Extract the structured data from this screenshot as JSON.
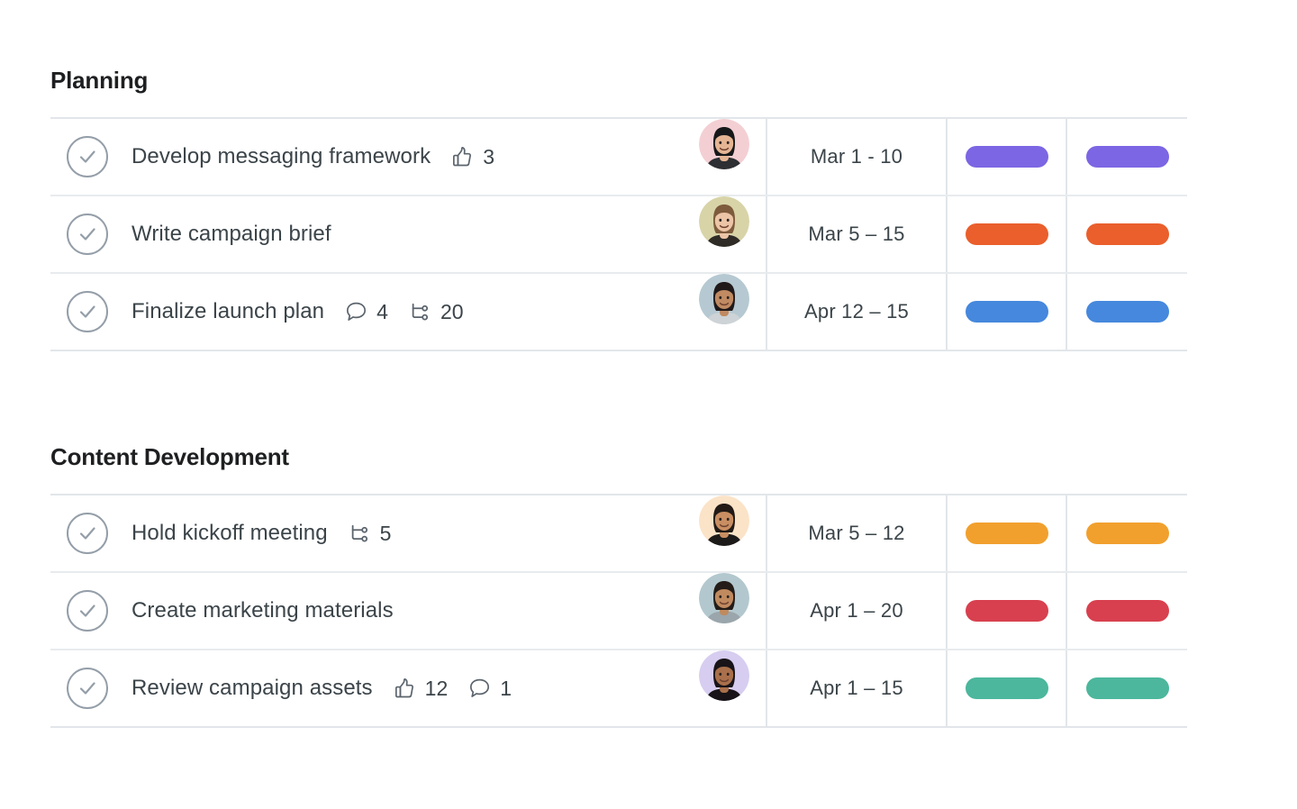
{
  "sections": [
    {
      "id": "planning",
      "title": "Planning",
      "rows": [
        {
          "task": "Develop messaging framework",
          "status_icon": "check-circle-icon",
          "meta": [
            {
              "icon": "thumbs-up-icon",
              "count": "3"
            }
          ],
          "assignee_avatar_bg": "#f3cfd3",
          "assignee_avatar_hair": "#17181a",
          "assignee_avatar_skin": "#e5b594",
          "assignee_avatar_shirt": "#2d2f33",
          "date": "Mar 1 - 10",
          "pill_color": "#7c66e3",
          "pill2_color": "#7c66e3"
        },
        {
          "task": "Write campaign brief",
          "status_icon": "check-circle-icon",
          "meta": [],
          "assignee_avatar_bg": "#d8d4a8",
          "assignee_avatar_hair": "#7d5b3c",
          "assignee_avatar_skin": "#ecc4a6",
          "assignee_avatar_shirt": "#2f2b27",
          "date": "Mar 5 – 15",
          "pill_color": "#ea5f2c",
          "pill2_color": "#ea5f2c"
        },
        {
          "task": "Finalize launch plan",
          "status_icon": "check-circle-icon",
          "meta": [
            {
              "icon": "comment-icon",
              "count": "4"
            },
            {
              "icon": "subtask-icon",
              "count": "20"
            }
          ],
          "assignee_avatar_bg": "#b6c9d2",
          "assignee_avatar_hair": "#20191a",
          "assignee_avatar_skin": "#c08a62",
          "assignee_avatar_shirt": "#cdd3d6",
          "date": "Apr 12 – 15",
          "pill_color": "#4688dd",
          "pill2_color": "#4688dd"
        }
      ]
    },
    {
      "id": "content-development",
      "title": "Content Development",
      "rows": [
        {
          "task": "Hold kickoff meeting",
          "status_icon": "check-circle-icon",
          "meta": [
            {
              "icon": "subtask-icon",
              "count": "5"
            }
          ],
          "assignee_avatar_bg": "#fbe3c8",
          "assignee_avatar_hair": "#221a16",
          "assignee_avatar_skin": "#c98e62",
          "assignee_avatar_shirt": "#1d1b1a",
          "date": "Mar 5 – 12",
          "pill_color": "#f1a02d",
          "pill2_color": "#f1a02d"
        },
        {
          "task": "Create marketing materials",
          "status_icon": "check-circle-icon",
          "meta": [],
          "assignee_avatar_bg": "#b3c8ce",
          "assignee_avatar_hair": "#241c18",
          "assignee_avatar_skin": "#c08a5f",
          "assignee_avatar_shirt": "#9aa6ac",
          "date": "Apr 1 – 20",
          "pill_color": "#d8404f",
          "pill2_color": "#d8404f"
        },
        {
          "task": "Review campaign assets",
          "status_icon": "check-circle-icon",
          "meta": [
            {
              "icon": "thumbs-up-icon",
              "count": "12"
            },
            {
              "icon": "comment-icon",
              "count": "1"
            }
          ],
          "assignee_avatar_bg": "#d7cdf0",
          "assignee_avatar_hair": "#191418",
          "assignee_avatar_skin": "#a9704b",
          "assignee_avatar_shirt": "#171317",
          "date": "Apr 1 – 15",
          "pill_color": "#4cb79d",
          "pill2_color": "#4cb79d"
        }
      ]
    }
  ],
  "colors": {
    "grid_line": "#e2e6ea",
    "row_line": "#e8ebee",
    "text": "#3b4449",
    "heading": "#1e1f21",
    "check_outline": "#949ea8"
  }
}
